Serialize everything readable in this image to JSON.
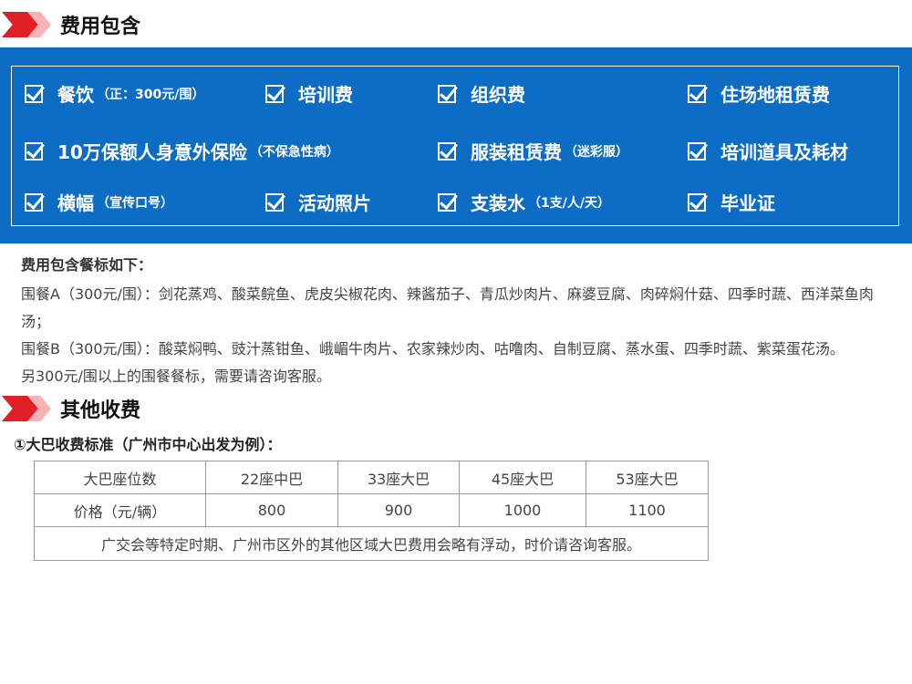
{
  "section1": {
    "title": "费用包含"
  },
  "included": [
    {
      "main": "餐饮",
      "note": "（正：300元/围）",
      "icon": "checkbox-icon"
    },
    {
      "main": "培训费",
      "note": "",
      "icon": "checkbox-icon"
    },
    {
      "main": "组织费",
      "note": "",
      "icon": "checkbox-icon"
    },
    {
      "main": "住场地租赁费",
      "note": "",
      "icon": "checkbox-icon"
    },
    {
      "main": "10万保额人身意外保险",
      "note": "（不保急性病）",
      "icon": "checkbox-icon"
    },
    {
      "main": "服装租赁费",
      "note": "（迷彩服）",
      "icon": "checkbox-icon"
    },
    {
      "main": "培训道具及耗材",
      "note": "",
      "icon": "checkbox-icon"
    },
    {
      "main": "横幅",
      "note": "（宣传口号）",
      "icon": "checkbox-icon"
    },
    {
      "main": "活动照片",
      "note": "",
      "icon": "checkbox-icon"
    },
    {
      "main": "支装水",
      "note": "（1支/人/天）",
      "icon": "checkbox-icon"
    },
    {
      "main": "毕业证",
      "note": "",
      "icon": "checkbox-icon"
    }
  ],
  "meals": {
    "heading": "费用包含餐标如下：",
    "lines": [
      "围餐A（300元/围）：剑花蒸鸡、酸菜鲩鱼、虎皮尖椒花肉、辣酱茄子、青瓜炒肉片、麻婆豆腐、肉碎焖什菇、四季时蔬、西洋菜鱼肉汤；",
      "围餐B（300元/围）：酸菜焖鸭、豉汁蒸钳鱼、峨嵋牛肉片、农家辣炒肉、咕噜肉、自制豆腐、蒸水蛋、四季时蔬、紫菜蛋花汤。",
      "另300元/围以上的围餐餐标，需要请咨询客服。"
    ]
  },
  "section2": {
    "title": "其他收费"
  },
  "bus": {
    "heading": "①大巴收费标准（广州市中心出发为例）：",
    "header": [
      "大巴座位数",
      "22座中巴",
      "33座大巴",
      "45座大巴",
      "53座大巴"
    ],
    "prices": [
      "价格（元/辆）",
      "800",
      "900",
      "1000",
      "1100"
    ],
    "note": "广交会等特定时期、广州市区外的其他区域大巴费用会略有浮动，时价请咨询客服。"
  },
  "colors": {
    "band": "#0d6cc4",
    "chevron": "#e01f26",
    "chevron_light": "#f5b3b5"
  }
}
